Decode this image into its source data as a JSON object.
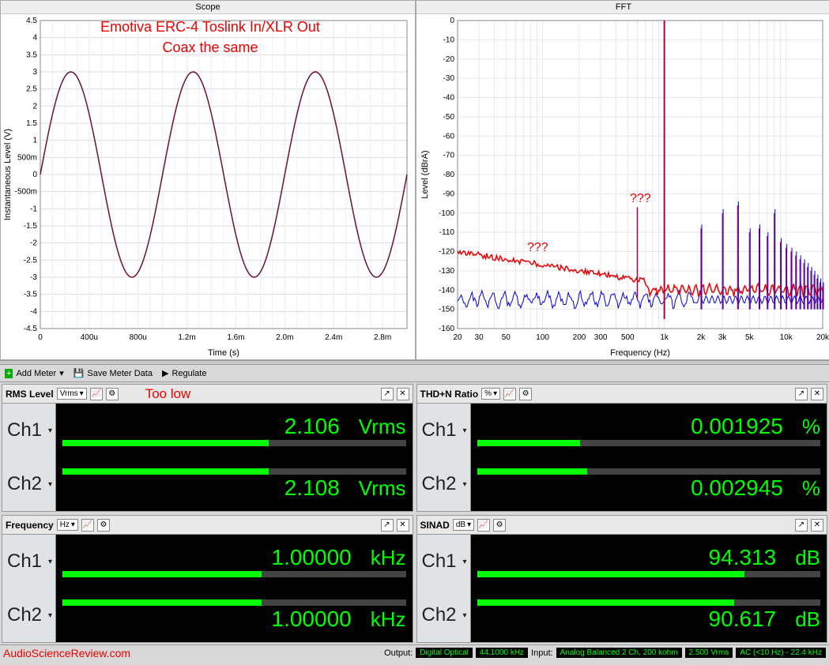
{
  "chart_data": [
    {
      "type": "line",
      "title": "Scope",
      "xlabel": "Time (s)",
      "ylabel": "Instantaneous Level (V)",
      "xticks": [
        "0",
        "400u",
        "800u",
        "1.2m",
        "1.6m",
        "2.0m",
        "2.4m",
        "2.8m"
      ],
      "yticks": [
        -4.5,
        -4.0,
        -3.5,
        -3.0,
        -2.5,
        -2.0,
        -1.5,
        -1.0,
        "-500m",
        0,
        "500m",
        1.0,
        1.5,
        2.0,
        2.5,
        3.0,
        3.5,
        4.0,
        4.5
      ],
      "xlim": [
        0,
        0.003
      ],
      "ylim": [
        -4.5,
        4.5
      ],
      "amplitude": 3.0,
      "frequency_hz": 1000,
      "annotations": [
        {
          "text": "Emotiva ERC-4 Toslink In/XLR Out",
          "x": 0.5,
          "y": 0.93
        },
        {
          "text": "Coax the same",
          "x": 0.5,
          "y": 0.86
        }
      ]
    },
    {
      "type": "line",
      "title": "FFT",
      "xlabel": "Frequency (Hz)",
      "ylabel": "Level (dBrA)",
      "xscale": "log",
      "xticks": [
        20,
        30,
        50,
        100,
        200,
        300,
        500,
        "1k",
        "2k",
        "3k",
        "5k",
        "10k",
        "20k"
      ],
      "yticks": [
        0,
        -10,
        -20,
        -30,
        -40,
        -50,
        -60,
        -70,
        -80,
        -90,
        -100,
        -110,
        -120,
        -130,
        -140,
        -150,
        -160
      ],
      "xlim": [
        20,
        20000
      ],
      "ylim": [
        -160,
        0
      ],
      "series": [
        {
          "name": "Ch1",
          "color": "#e00",
          "fundamental_hz": 1000,
          "fundamental_db": 0,
          "noise_floor_db_20hz": -120,
          "noise_floor_db_1k": -135,
          "spur_600hz_db": -97
        },
        {
          "name": "Ch2",
          "color": "#00e",
          "fundamental_hz": 1000,
          "fundamental_db": 0,
          "noise_floor_db": -145,
          "spur_600hz_db": -97
        }
      ],
      "harmonics_db": [
        -108,
        -100,
        -96,
        -110,
        -108,
        -112,
        -100,
        -115,
        -118,
        -120,
        -122,
        -124,
        -126,
        -128,
        -130,
        -132,
        -134,
        -136,
        -138
      ],
      "annotations": [
        {
          "text": "???",
          "x_hz": 130,
          "y_db": -115
        },
        {
          "text": "???",
          "x_hz": 600,
          "y_db": -85
        }
      ]
    }
  ],
  "toolbar": {
    "add_meter": "Add Meter",
    "save_meter": "Save Meter Data",
    "regulate": "Regulate"
  },
  "meters": {
    "rms": {
      "label": "RMS Level",
      "unit": "Vrms",
      "annotation": "Too low",
      "ch1": {
        "value": "2.106",
        "unit": "Vrms",
        "fill": 60
      },
      "ch2": {
        "value": "2.108",
        "unit": "Vrms",
        "fill": 60
      }
    },
    "thdn": {
      "label": "THD+N Ratio",
      "unit": "%",
      "ch1": {
        "value": "0.001925",
        "unit": "%",
        "fill": 30
      },
      "ch2": {
        "value": "0.002945",
        "unit": "%",
        "fill": 32
      }
    },
    "freq": {
      "label": "Frequency",
      "unit": "Hz",
      "ch1": {
        "value": "1.00000",
        "unit": "kHz",
        "fill": 58
      },
      "ch2": {
        "value": "1.00000",
        "unit": "kHz",
        "fill": 58
      }
    },
    "sinad": {
      "label": "SINAD",
      "unit": "dB",
      "ch1": {
        "value": "94.313",
        "unit": "dB",
        "fill": 78
      },
      "ch2": {
        "value": "90.617",
        "unit": "dB",
        "fill": 75
      }
    }
  },
  "footer": {
    "site": "AudioScienceReview.com",
    "output_label": "Output:",
    "output_type": "Digital Optical",
    "output_rate": "44.1000 kHz",
    "input_label": "Input:",
    "input_type": "Analog Balanced 2 Ch, 200 kohm",
    "input_range": "2.500 Vrms",
    "input_bw": "AC (<10 Hz) - 22.4 kHz"
  },
  "ch_labels": {
    "ch1": "Ch1",
    "ch2": "Ch2"
  }
}
